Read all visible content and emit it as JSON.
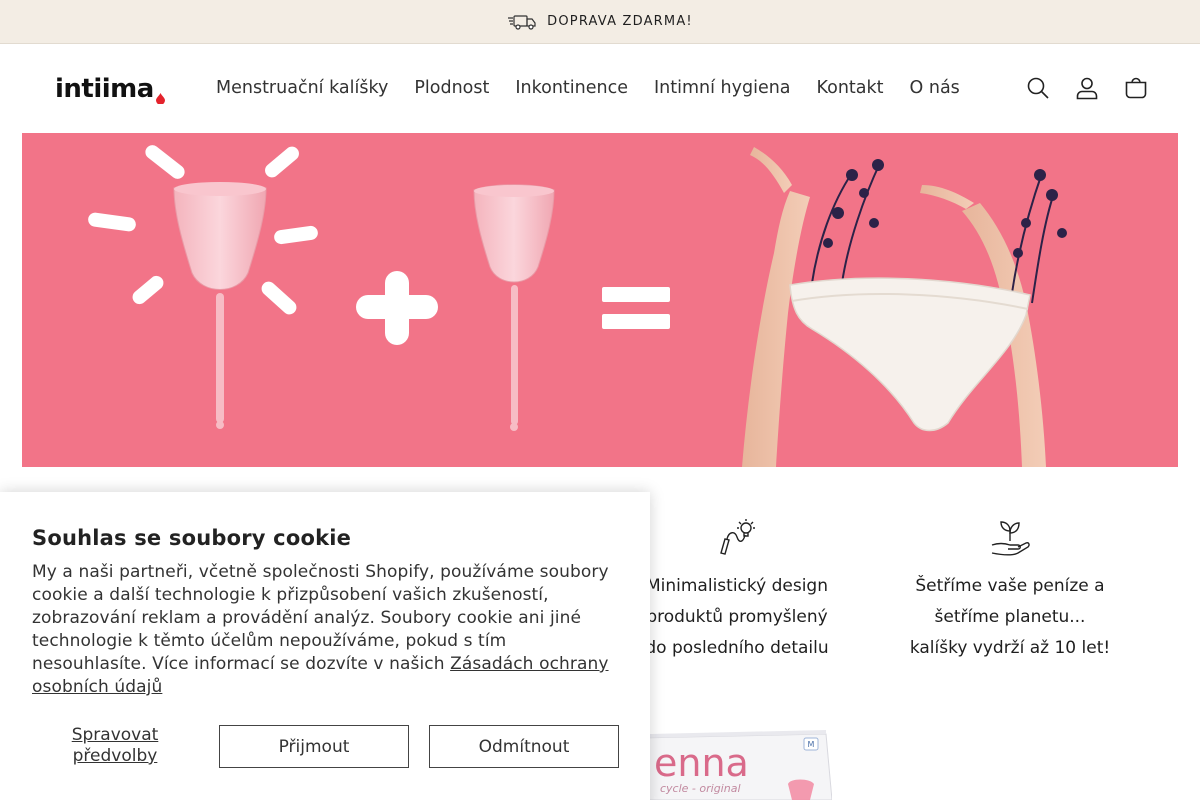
{
  "announcement": {
    "text": "DOPRAVA ZDARMA!",
    "icon": "truck-icon"
  },
  "header": {
    "logo_text": "intiima",
    "nav": [
      {
        "label": "Menstruační kalíšky"
      },
      {
        "label": "Plodnost"
      },
      {
        "label": "Inkontinence"
      },
      {
        "label": "Intimní hygiena"
      },
      {
        "label": "Kontakt"
      },
      {
        "label": "O nás"
      }
    ],
    "icons": [
      "search-icon",
      "account-icon",
      "cart-icon"
    ]
  },
  "hero": {
    "accent_color": "#f27488",
    "description_icons": [
      "menstrual-cup",
      "plus",
      "menstrual-cup",
      "equals",
      "underwear"
    ]
  },
  "features": [
    {
      "icon": "lightbulb-pencil-icon",
      "lines": [
        "Minimalistický design",
        "produktů promyšlený",
        "do posledního detailu"
      ]
    },
    {
      "icon": "plant-hand-icon",
      "lines": [
        "Šetříme vaše peníze a",
        "šetříme planetu...",
        "kalíšky vydrží až 10 let!"
      ]
    }
  ],
  "product": {
    "brand": "enna",
    "subtitle": "cycle - original",
    "size_badge": "M"
  },
  "cookie": {
    "title": "Souhlas se soubory cookie",
    "body": "My a naši partneři, včetně společnosti Shopify, používáme soubory cookie a další technologie k přizpůsobení vašich zkušeností, zobrazování reklam a provádění analýz. Soubory cookie ani jiné technologie k těmto účelům nepoužíváme, pokud s tím nesouhlasíte. Více informací se dozvíte v našich ",
    "link": "Zásadách ochrany osobních údajů",
    "manage": "Spravovat předvolby",
    "accept": "Přijmout",
    "decline": "Odmítnout"
  }
}
